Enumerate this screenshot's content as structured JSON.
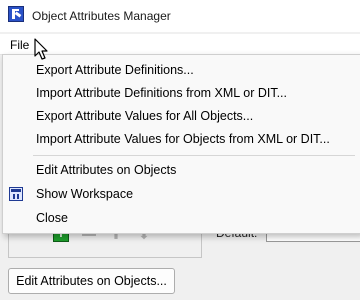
{
  "window": {
    "title": "Object Attributes Manager"
  },
  "menubar": {
    "file_label": "File"
  },
  "file_menu": {
    "items": [
      "Export Attribute Definitions...",
      "Import Attribute Definitions from XML or DIT...",
      "Export Attribute Values for All Objects...",
      "Import Attribute Values for Objects from XML or DIT...",
      "Edit Attributes on Objects",
      "Show Workspace",
      "Close"
    ]
  },
  "background": {
    "default_label": "Default:",
    "default_value": "",
    "edit_button_label": "Edit Attributes on Objects..."
  },
  "icons": {
    "app": "riverware-r-icon",
    "show_workspace": "workspace-icon",
    "add": "plus-icon",
    "remove": "minus-icon",
    "move_up": "arrow-up-icon",
    "move_down": "arrow-down-icon"
  },
  "colors": {
    "add_icon": "#1d9e2c",
    "app_icon": "#2a52c8"
  }
}
